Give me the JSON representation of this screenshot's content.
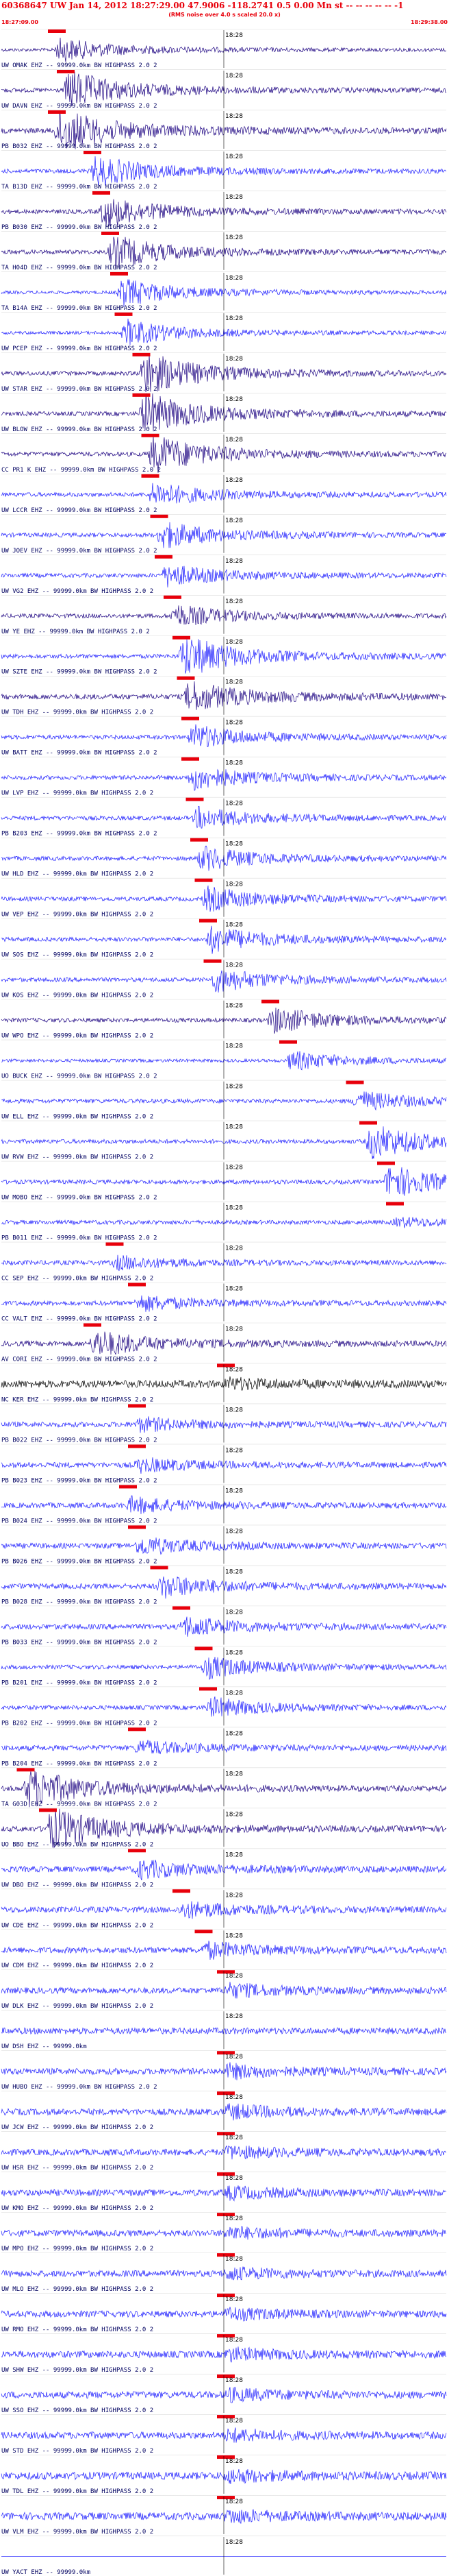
{
  "header": {
    "title": "60368647 UW Jan 14, 2012 18:27:29.00   47.9006 -118.2741  0.5 0.00 Mn st -- -- -- -- -- -1",
    "subtitle": "(RMS noise over 4.0 s scaled 20.0 x)",
    "start_time": "18:27:09.00",
    "end_time": "18:29:38.00"
  },
  "chart_data": {
    "type": "line",
    "title": "60368647 UW Jan 14, 2012 18:27:29.00   47.9006 -118.2741  0.5 0.00 Mn st -- -- -- -- -- -1",
    "time_window": {
      "start": "18:27:09.00",
      "end": "18:29:38.00"
    },
    "center_tick_label": "18:28",
    "colors": {
      "dark": "#1a0080",
      "blue": "#1c1cff",
      "black": "#000000",
      "pick": "#e8000b"
    },
    "traces": [
      {
        "label": "UW OMAK EHZ -- 99999.0km BW HIGHPASS 2.0 2",
        "color": "dark",
        "event": 0.12,
        "amp": 0.55,
        "noise": 0.15
      },
      {
        "label": "UW DAVN EHZ -- 99999.0km BW HIGHPASS 2.0 2",
        "color": "dark",
        "event": 0.14,
        "amp": 0.9,
        "noise": 0.2
      },
      {
        "label": "PB B032 EHZ -- 99999.0km BW HIGHPASS 2.0 2",
        "color": "dark",
        "event": 0.12,
        "amp": 1.0,
        "noise": 0.25
      },
      {
        "label": "TA B13D EHZ -- 99999.0km BW HIGHPASS 2.0 2",
        "color": "blue",
        "event": 0.2,
        "amp": 0.7,
        "noise": 0.2
      },
      {
        "label": "PB B030 EHZ -- 99999.0km BW HIGHPASS 2.0 2",
        "color": "dark",
        "event": 0.22,
        "amp": 0.7,
        "noise": 0.2
      },
      {
        "label": "TA H04D EHZ -- 99999.0km BW HIGHPASS 2.0 2",
        "color": "dark",
        "event": 0.24,
        "amp": 0.75,
        "noise": 0.2
      },
      {
        "label": "TA B14A EHZ -- 99999.0km BW HIGHPASS 2.0 2",
        "color": "blue",
        "event": 0.26,
        "amp": 0.65,
        "noise": 0.15
      },
      {
        "label": "UW PCEP EHZ -- 99999.0km BW HIGHPASS 2.0 2",
        "color": "blue",
        "event": 0.27,
        "amp": 0.6,
        "noise": 0.15
      },
      {
        "label": "UW STAR EHZ -- 99999.0km BW HIGHPASS 2.0 2",
        "color": "dark",
        "event": 0.31,
        "amp": 1.0,
        "noise": 0.2
      },
      {
        "label": "UW BLOW EHZ -- 99999.0km BW HIGHPASS 2.0 2",
        "color": "dark",
        "event": 0.31,
        "amp": 1.0,
        "noise": 0.2
      },
      {
        "label": "CC PR1 K EHZ -- 99999.0km BW HIGHPASS 2.0 2",
        "color": "dark",
        "event": 0.33,
        "amp": 0.9,
        "noise": 0.2
      },
      {
        "label": "UW LCCR EHZ -- 99999.0km BW HIGHPASS 2.0 2",
        "color": "blue",
        "event": 0.33,
        "amp": 0.55,
        "noise": 0.2
      },
      {
        "label": "UW JOEV EHZ -- 99999.0km BW HIGHPASS 2.0 2",
        "color": "blue",
        "event": 0.35,
        "amp": 0.6,
        "noise": 0.2
      },
      {
        "label": "UW VG2 EHZ -- 99999.0km BW HIGHPASS 2.0 2",
        "color": "blue",
        "event": 0.36,
        "amp": 0.5,
        "noise": 0.2
      },
      {
        "label": "UW YE EHZ -- 99999.0km BW HIGHPASS 2.0 2",
        "color": "dark",
        "event": 0.38,
        "amp": 0.5,
        "noise": 0.2
      },
      {
        "label": "UW SZTE EHZ -- 99999.0km BW HIGHPASS 2.0 2",
        "color": "blue",
        "event": 0.4,
        "amp": 0.95,
        "noise": 0.2
      },
      {
        "label": "UW TDH EHZ -- 99999.0km BW HIGHPASS 2.0 2",
        "color": "dark",
        "event": 0.41,
        "amp": 0.7,
        "noise": 0.25
      },
      {
        "label": "UW BATT EHZ -- 99999.0km BW HIGHPASS 2.0 2",
        "color": "blue",
        "event": 0.42,
        "amp": 0.55,
        "noise": 0.2
      },
      {
        "label": "UW LVP EHZ -- 99999.0km BW HIGHPASS 2.0 2",
        "color": "blue",
        "event": 0.42,
        "amp": 0.55,
        "noise": 0.2
      },
      {
        "label": "PB B203 EHZ -- 99999.0km BW HIGHPASS 2.0 2",
        "color": "blue",
        "event": 0.43,
        "amp": 0.5,
        "noise": 0.2
      },
      {
        "label": "UW HLD EHZ -- 99999.0km BW HIGHPASS 2.0 2",
        "color": "blue",
        "event": 0.44,
        "amp": 0.55,
        "noise": 0.2
      },
      {
        "label": "UW VEP EHZ -- 99999.0km BW HIGHPASS 2.0 2",
        "color": "blue",
        "event": 0.45,
        "amp": 0.55,
        "noise": 0.2
      },
      {
        "label": "UW SOS EHZ -- 99999.0km BW HIGHPASS 2.0 2",
        "color": "blue",
        "event": 0.46,
        "amp": 0.6,
        "noise": 0.2
      },
      {
        "label": "UW KOS EHZ -- 99999.0km BW HIGHPASS 2.0 2",
        "color": "blue",
        "event": 0.47,
        "amp": 0.55,
        "noise": 0.2
      },
      {
        "label": "UW WPO EHZ -- 99999.0km BW HIGHPASS 2.0 2",
        "color": "dark",
        "event": 0.6,
        "amp": 0.6,
        "noise": 0.2
      },
      {
        "label": "UO BUCK EHZ -- 99999.0km BW HIGHPASS 2.0 2",
        "color": "blue",
        "event": 0.64,
        "amp": 0.45,
        "noise": 0.15
      },
      {
        "label": "UW ELL EHZ -- 99999.0km BW HIGHPASS 2.0 2",
        "color": "blue",
        "event": 0.79,
        "amp": 0.45,
        "noise": 0.2
      },
      {
        "label": "UW RVW EHZ -- 99999.0km BW HIGHPASS 2.0 2",
        "color": "blue",
        "event": 0.82,
        "amp": 0.8,
        "noise": 0.2
      },
      {
        "label": "UW MOBO EHZ -- 99999.0km BW HIGHPASS 2.0 2",
        "color": "blue",
        "event": 0.86,
        "amp": 0.75,
        "noise": 0.2
      },
      {
        "label": "PB B011 EHZ -- 99999.0km BW HIGHPASS 2.0 2",
        "color": "blue",
        "event": 0.88,
        "amp": 0.2,
        "noise": 0.2
      },
      {
        "label": "CC SEP EHZ -- 99999.0km BW HIGHPASS 2.0 2",
        "color": "blue",
        "event": 0.25,
        "amp": 0.3,
        "noise": 0.22
      },
      {
        "label": "CC VALT EHZ -- 99999.0km BW HIGHPASS 2.0 2",
        "color": "blue",
        "event": 0.3,
        "amp": 0.35,
        "noise": 0.22
      },
      {
        "label": "AV CORI EHZ -- 99999.0km BW HIGHPASS 2.0 2",
        "color": "dark",
        "event": 0.2,
        "amp": 0.6,
        "noise": 0.25
      },
      {
        "label": "NC KER EHZ -- 99999.0km BW HIGHPASS 2.0 2",
        "color": "black",
        "event": 0.5,
        "amp": 0.2,
        "noise": 0.35
      },
      {
        "label": "PB B022 EHZ -- 99999.0km BW HIGHPASS 2.0 2",
        "color": "blue",
        "event": 0.3,
        "amp": 0.3,
        "noise": 0.25
      },
      {
        "label": "PB B023 EHZ -- 99999.0km BW HIGHPASS 2.0 2",
        "color": "blue",
        "event": 0.3,
        "amp": 0.3,
        "noise": 0.25
      },
      {
        "label": "PB B024 EHZ -- 99999.0km BW HIGHPASS 2.0 2",
        "color": "blue",
        "event": 0.28,
        "amp": 0.35,
        "noise": 0.25
      },
      {
        "label": "PB B026 EHZ -- 99999.0km BW HIGHPASS 2.0 2",
        "color": "blue",
        "event": 0.3,
        "amp": 0.4,
        "noise": 0.25
      },
      {
        "label": "PB B028 EHZ -- 99999.0km BW HIGHPASS 2.0 2",
        "color": "blue",
        "event": 0.35,
        "amp": 0.5,
        "noise": 0.25
      },
      {
        "label": "PB B033 EHZ -- 99999.0km BW HIGHPASS 2.0 2",
        "color": "blue",
        "event": 0.4,
        "amp": 0.45,
        "noise": 0.25
      },
      {
        "label": "PB B201 EHZ -- 99999.0km BW HIGHPASS 2.0 2",
        "color": "blue",
        "event": 0.45,
        "amp": 0.5,
        "noise": 0.2
      },
      {
        "label": "PB B202 EHZ -- 99999.0km BW HIGHPASS 2.0 2",
        "color": "blue",
        "event": 0.46,
        "amp": 0.45,
        "noise": 0.2
      },
      {
        "label": "PB B204 EHZ -- 99999.0km BW HIGHPASS 2.0 2",
        "color": "blue",
        "event": 0.3,
        "amp": 0.3,
        "noise": 0.25
      },
      {
        "label": "TA G03D EHZ -- 99999.0km BW HIGHPASS 2.0 2",
        "color": "dark",
        "event": 0.05,
        "amp": 0.9,
        "noise": 0.25
      },
      {
        "label": "UO BBO EHZ -- 99999.0km BW HIGHPASS 2.0 2",
        "color": "dark",
        "event": 0.1,
        "amp": 0.95,
        "noise": 0.25
      },
      {
        "label": "UW DBO EHZ -- 99999.0km BW HIGHPASS 2.0 2",
        "color": "blue",
        "event": 0.3,
        "amp": 0.4,
        "noise": 0.28
      },
      {
        "label": "UW CDE EHZ -- 99999.0km BW HIGHPASS 2.0 2",
        "color": "blue",
        "event": 0.4,
        "amp": 0.35,
        "noise": 0.28
      },
      {
        "label": "UW CDM EHZ -- 99999.0km BW HIGHPASS 2.0 2",
        "color": "blue",
        "event": 0.45,
        "amp": 0.35,
        "noise": 0.28
      },
      {
        "label": "UW DLK EHZ -- 99999.0km BW HIGHPASS 2.0 2",
        "color": "blue",
        "event": 0.5,
        "amp": 0.3,
        "noise": 0.28
      },
      {
        "label": "UW DSH EHZ -- 99999.0km",
        "color": "blue",
        "event": 0.5,
        "amp": 0.0,
        "noise": 0.3
      },
      {
        "label": "UW HUBO EHZ -- 99999.0km BW HIGHPASS 2.0 2",
        "color": "blue",
        "event": 0.5,
        "amp": 0.3,
        "noise": 0.3
      },
      {
        "label": "UW JCW EHZ -- 99999.0km BW HIGHPASS 2.0 2",
        "color": "blue",
        "event": 0.5,
        "amp": 0.3,
        "noise": 0.3
      },
      {
        "label": "UW HSR EHZ -- 99999.0km BW HIGHPASS 2.0 2",
        "color": "blue",
        "event": 0.5,
        "amp": 0.25,
        "noise": 0.3
      },
      {
        "label": "UW KMO EHZ -- 99999.0km BW HIGHPASS 2.0 2",
        "color": "blue",
        "event": 0.5,
        "amp": 0.25,
        "noise": 0.3
      },
      {
        "label": "UW MPO EHZ -- 99999.0km BW HIGHPASS 2.0 2",
        "color": "blue",
        "event": 0.5,
        "amp": 0.25,
        "noise": 0.3
      },
      {
        "label": "UW MLO EHZ -- 99999.0km BW HIGHPASS 2.0 2",
        "color": "blue",
        "event": 0.5,
        "amp": 0.25,
        "noise": 0.3
      },
      {
        "label": "UW RMO EHZ -- 99999.0km BW HIGHPASS 2.0 2",
        "color": "blue",
        "event": 0.5,
        "amp": 0.25,
        "noise": 0.3
      },
      {
        "label": "UW SHW EHZ -- 99999.0km BW HIGHPASS 2.0 2",
        "color": "blue",
        "event": 0.5,
        "amp": 0.25,
        "noise": 0.32
      },
      {
        "label": "UW SSO EHZ -- 99999.0km BW HIGHPASS 2.0 2",
        "color": "blue",
        "event": 0.5,
        "amp": 0.25,
        "noise": 0.32
      },
      {
        "label": "UW STD EHZ -- 99999.0km BW HIGHPASS 2.0 2",
        "color": "blue",
        "event": 0.5,
        "amp": 0.25,
        "noise": 0.32
      },
      {
        "label": "UW TDL EHZ -- 99999.0km BW HIGHPASS 2.0 2",
        "color": "blue",
        "event": 0.5,
        "amp": 0.25,
        "noise": 0.35
      },
      {
        "label": "UW VLM EHZ -- 99999.0km BW HIGHPASS 2.0 2",
        "color": "blue",
        "event": 0.5,
        "amp": 0.25,
        "noise": 0.35
      },
      {
        "label": "UW YACT EHZ -- 99999.0km",
        "color": "blue",
        "event": 0.5,
        "amp": 0.0,
        "noise": 0.0
      }
    ]
  }
}
